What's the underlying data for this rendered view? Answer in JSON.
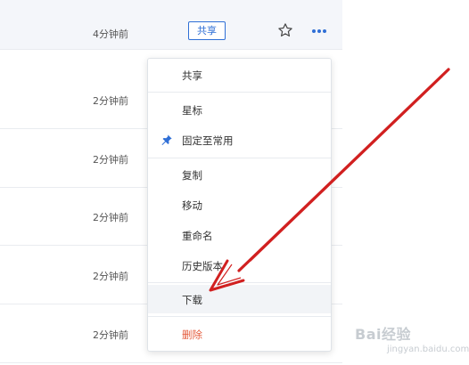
{
  "file_rows": [
    {
      "time": "4分钟前",
      "share_label": "共享"
    },
    {
      "time": "2分钟前"
    },
    {
      "time": "2分钟前"
    },
    {
      "time": "2分钟前"
    },
    {
      "time": "2分钟前"
    },
    {
      "time": "2分钟前"
    }
  ],
  "context_menu": {
    "items": [
      {
        "label": "共享"
      },
      {
        "label": "星标"
      },
      {
        "label": "固定至常用",
        "icon": "pin-icon"
      },
      {
        "label": "复制"
      },
      {
        "label": "移动"
      },
      {
        "label": "重命名"
      },
      {
        "label": "历史版本"
      },
      {
        "label": "下载",
        "highlighted": true
      },
      {
        "label": "删除",
        "color": "#e45a3b"
      }
    ]
  },
  "annotation": {
    "arrow_color": "#d12020"
  },
  "watermark": {
    "text": "Bai经验",
    "subtext": "jingyan.baidu.com"
  },
  "colors": {
    "accent": "#2f6fd6",
    "row_hover": "#f4f6fa",
    "danger": "#e45a3b"
  }
}
